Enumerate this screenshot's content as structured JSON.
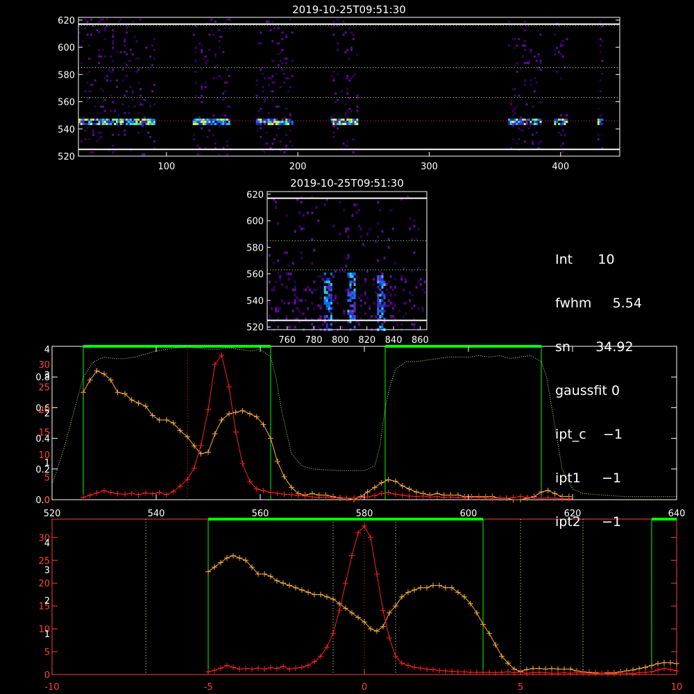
{
  "title_top": "2019-10-25T09:51:30",
  "title_mid": "2019-10-25T09:51:30",
  "info": [
    {
      "label": "Int",
      "value": "10"
    },
    {
      "label": "fwhm",
      "value": "5.54"
    },
    {
      "label": "sn",
      "value": "34.92"
    },
    {
      "label": "gaussfit",
      "value": "0"
    },
    {
      "label": "ipt_c",
      "value": "−1"
    },
    {
      "label": "ipt1",
      "value": "−1"
    },
    {
      "label": "ipt2",
      "value": "−1"
    }
  ],
  "colors": {
    "axes": "#ffffff",
    "red_curve": "#ff2020",
    "orange_curve": "#ffb040",
    "green": "#00ff00",
    "green_dotted": "#b0ff80",
    "red_axis": "#ff4040",
    "yellow_dotted": "#ffff80"
  },
  "chart_data": [
    {
      "type": "heatmap",
      "title": "2019-10-25T09:51:30",
      "xlim": [
        33,
        445
      ],
      "ylim": [
        520,
        622
      ],
      "xticks": [
        100,
        200,
        300,
        400
      ],
      "yticks": [
        520,
        540,
        560,
        580,
        600,
        620
      ],
      "hlines_solid": [
        525,
        617
      ],
      "hlines_dotted_green": [
        563,
        585,
        616
      ],
      "hline_dotted_red": 546,
      "active_columns": [
        [
          33,
          90
        ],
        [
          120,
          148
        ],
        [
          168,
          195
        ],
        [
          225,
          245
        ],
        [
          360,
          385
        ],
        [
          395,
          405
        ],
        [
          428,
          432
        ]
      ],
      "bright_band_y": 546
    },
    {
      "type": "heatmap",
      "title": "2019-10-25T09:51:30",
      "xlim": [
        745,
        865
      ],
      "ylim": [
        518,
        622
      ],
      "xticks": [
        760,
        780,
        800,
        820,
        840,
        860
      ],
      "yticks": [
        520,
        540,
        560,
        580,
        600,
        620
      ],
      "hlines_solid": [
        525,
        617
      ],
      "hlines_dotted_green": [
        563,
        585
      ],
      "bright_streaks_x": [
        790,
        808,
        830
      ]
    },
    {
      "type": "line",
      "xlim": [
        520,
        640
      ],
      "xticks": [
        520,
        540,
        560,
        580,
        600,
        620,
        640
      ],
      "ylim_left": [
        0,
        1
      ],
      "yticks_left_white": [
        "0.0",
        "0.2",
        "0.4",
        "0.6",
        "0.8"
      ],
      "yticks_left_red": [
        "0",
        "5",
        "10",
        "15",
        "20",
        "25",
        "30"
      ],
      "yticks_left_white2": [
        "1",
        "2",
        "3",
        "4"
      ],
      "green_bars": [
        [
          526,
          562
        ],
        [
          584,
          614
        ]
      ],
      "series": [
        {
          "color": "red",
          "x": [
            526,
            527.3,
            528.6,
            530,
            531.3,
            532.6,
            534,
            535.3,
            536.6,
            538,
            539.3,
            540.6,
            542,
            543.3,
            544.6,
            546,
            547.3,
            548.6,
            550,
            551.3,
            552.6,
            554,
            555.3,
            556.6,
            558,
            559.3,
            560.6,
            562,
            563.3,
            564.6,
            566,
            567.3,
            568.6,
            570,
            571.3,
            572.6,
            574,
            575.3,
            576.6,
            578,
            579.3,
            580.6,
            582,
            583.3,
            584.6,
            586,
            587.3,
            588.6,
            590,
            591.3,
            592.6,
            594,
            595.3,
            596.6,
            598,
            599.3,
            600.6,
            602,
            603.3,
            604.6,
            606,
            607.3,
            608.6,
            610,
            611.3,
            612.6,
            614,
            615.3,
            616.6,
            618,
            619.3
          ],
          "y": [
            0.5,
            1,
            1.5,
            2,
            1.6,
            1.3,
            1.2,
            1.4,
            1.1,
            1.5,
            1.3,
            1.6,
            1.1,
            1.8,
            3,
            4.5,
            7,
            12,
            20,
            30,
            32,
            25,
            15,
            8,
            4,
            2.4,
            2,
            1.6,
            1.4,
            1.2,
            1.1,
            0.9,
            0.8,
            0.6,
            0.5,
            0.6,
            0.4,
            0.5,
            0.3,
            0.4,
            0.5,
            0.6,
            0.9,
            1.4,
            1.6,
            1.2,
            1.0,
            0.8,
            0.7,
            0.8,
            0.6,
            0.7,
            0.5,
            0.6,
            0.5,
            0.4,
            0.5,
            0.5,
            0.4,
            0.3,
            0.4,
            0.3,
            0.5,
            0.7,
            0.5,
            0.4,
            0.3,
            0.4,
            0.3,
            0.2,
            0.2
          ]
        },
        {
          "color": "orange",
          "x": [
            526,
            527.3,
            528.6,
            530,
            531.3,
            532.6,
            534,
            535.3,
            536.6,
            538,
            539.3,
            540.6,
            542,
            543.3,
            544.6,
            546,
            547.3,
            548.6,
            550,
            551.3,
            552.6,
            554,
            555.3,
            556.6,
            558,
            559.3,
            560.6,
            562,
            563.3,
            564.6,
            566,
            567.3,
            568.6,
            570,
            571.3,
            572.6,
            574,
            575.3,
            576.6,
            578,
            579.3,
            580.6,
            582,
            583.3,
            584.6,
            586,
            587.3,
            588.6,
            590,
            591.3,
            592.6,
            594,
            595.3,
            596.6,
            598,
            599.3,
            600.6,
            602,
            603.3,
            604.6,
            606,
            607.3,
            608.6,
            610,
            611.3,
            612.6,
            614,
            615.3,
            616.6,
            618,
            619.3
          ],
          "y": [
            0.7,
            0.78,
            0.84,
            0.82,
            0.78,
            0.7,
            0.69,
            0.65,
            0.63,
            0.61,
            0.55,
            0.52,
            0.52,
            0.5,
            0.45,
            0.41,
            0.35,
            0.3,
            0.31,
            0.43,
            0.52,
            0.56,
            0.57,
            0.58,
            0.56,
            0.54,
            0.49,
            0.4,
            0.25,
            0.15,
            0.08,
            0.04,
            0.03,
            0.04,
            0.03,
            0.03,
            0.02,
            0.01,
            0.01,
            0.0,
            0.02,
            0.05,
            0.08,
            0.11,
            0.13,
            0.12,
            0.09,
            0.07,
            0.05,
            0.04,
            0.03,
            0.04,
            0.03,
            0.03,
            0.03,
            0.02,
            0.02,
            0.02,
            0.02,
            0.02,
            0.01,
            0.01,
            0.0,
            0.0,
            0.01,
            0.02,
            0.05,
            0.06,
            0.04,
            0.02,
            0.02
          ]
        },
        {
          "color": "green-dotted",
          "x": [
            520,
            522,
            524,
            526,
            528,
            530,
            532,
            534,
            536,
            538,
            540,
            542,
            544,
            546,
            548,
            550,
            552,
            554,
            556,
            558,
            560,
            562,
            563,
            564,
            565,
            566,
            568,
            570,
            575,
            580,
            582,
            583,
            584,
            585,
            586,
            588,
            590,
            592,
            594,
            596,
            598,
            600,
            602,
            604,
            606,
            608,
            610,
            612,
            614,
            615,
            616,
            617,
            618,
            620,
            622,
            626,
            630,
            636,
            640
          ],
          "y": [
            0.1,
            0.3,
            0.55,
            0.8,
            0.9,
            0.93,
            0.92,
            0.92,
            0.93,
            0.95,
            0.97,
            0.98,
            0.99,
            1.0,
            0.99,
            0.98,
            0.98,
            0.99,
            0.98,
            0.97,
            0.98,
            0.93,
            0.8,
            0.6,
            0.45,
            0.3,
            0.22,
            0.2,
            0.19,
            0.19,
            0.22,
            0.35,
            0.6,
            0.75,
            0.85,
            0.9,
            0.9,
            0.91,
            0.92,
            0.93,
            0.93,
            0.93,
            0.94,
            0.93,
            0.94,
            0.92,
            0.93,
            0.94,
            0.9,
            0.8,
            0.6,
            0.4,
            0.2,
            0.07,
            0.04,
            0.03,
            0.02,
            0.02,
            0.02
          ]
        }
      ]
    },
    {
      "type": "line",
      "xlim": [
        -10,
        10
      ],
      "xticks": [
        -10,
        -5,
        0,
        5,
        10
      ],
      "yticks_left_red": [
        "0",
        "5",
        "10",
        "15",
        "20",
        "25",
        "30"
      ],
      "yticks_left_white": [
        "1",
        "2",
        "3",
        "4"
      ],
      "green_bars": [
        [
          -5.0,
          3.8
        ],
        [
          9.2,
          10
        ]
      ],
      "vlines_yellow_dotted": [
        -7,
        -5,
        -1,
        0,
        1,
        5,
        7
      ],
      "series": [
        {
          "color": "red",
          "x": [
            -5.0,
            -4.8,
            -4.6,
            -4.4,
            -4.2,
            -4.0,
            -3.8,
            -3.6,
            -3.4,
            -3.2,
            -3.0,
            -2.8,
            -2.6,
            -2.4,
            -2.2,
            -2.0,
            -1.8,
            -1.6,
            -1.4,
            -1.2,
            -1.0,
            -0.8,
            -0.6,
            -0.4,
            -0.2,
            0.0,
            0.2,
            0.4,
            0.6,
            0.8,
            1.0,
            1.2,
            1.4,
            1.6,
            1.8,
            2.0,
            2.2,
            2.4,
            2.6,
            2.8,
            3.0,
            3.2,
            3.4,
            3.6,
            3.8,
            4.0,
            4.2,
            4.4,
            4.6,
            4.8,
            5.0,
            5.2,
            5.4,
            5.6,
            5.8,
            6.0,
            6.2,
            6.4,
            6.6,
            6.8,
            7.0,
            7.2,
            7.4,
            7.6,
            7.8,
            8.0,
            8.2,
            8.4,
            8.6,
            8.8,
            9.0,
            9.2,
            9.4,
            9.6,
            9.8,
            10.0
          ],
          "y": [
            0.6,
            0.9,
            1.4,
            2.0,
            1.6,
            1.2,
            1.3,
            1.2,
            1.4,
            1.2,
            1.5,
            1.3,
            1.8,
            1.2,
            1.4,
            1.6,
            2.0,
            2.8,
            4.0,
            6.0,
            9.0,
            14.0,
            20.0,
            26.0,
            31.0,
            32.5,
            30.0,
            22.0,
            14.0,
            8.0,
            4.0,
            2.5,
            2.0,
            1.6,
            1.4,
            1.2,
            1.1,
            0.9,
            0.8,
            0.7,
            0.6,
            0.6,
            0.5,
            0.5,
            0.5,
            0.5,
            0.4,
            0.5,
            0.6,
            0.4,
            0.5,
            0.3,
            0.4,
            0.5,
            0.4,
            0.3,
            0.3,
            0.4,
            0.3,
            0.4,
            0.3,
            0.3,
            0.2,
            0.3,
            0.2,
            0.2,
            0.3,
            0.3,
            0.2,
            0.4,
            0.5,
            0.6,
            1.0,
            1.3,
            1.1,
            0.8
          ]
        },
        {
          "color": "orange",
          "x": [
            -5.0,
            -4.8,
            -4.6,
            -4.4,
            -4.2,
            -4.0,
            -3.8,
            -3.6,
            -3.4,
            -3.2,
            -3.0,
            -2.8,
            -2.6,
            -2.4,
            -2.2,
            -2.0,
            -1.8,
            -1.6,
            -1.4,
            -1.2,
            -1.0,
            -0.8,
            -0.6,
            -0.4,
            -0.2,
            0.0,
            0.2,
            0.4,
            0.6,
            0.8,
            1.0,
            1.2,
            1.4,
            1.6,
            1.8,
            2.0,
            2.2,
            2.4,
            2.6,
            2.8,
            3.0,
            3.2,
            3.4,
            3.6,
            3.8,
            4.0,
            4.2,
            4.4,
            4.6,
            4.8,
            5.0,
            5.2,
            5.4,
            5.6,
            5.8,
            6.0,
            6.2,
            6.4,
            6.6,
            6.8,
            7.0,
            7.2,
            7.4,
            7.6,
            7.8,
            8.0,
            8.2,
            8.4,
            8.6,
            8.8,
            9.0,
            9.2,
            9.4,
            9.6,
            9.8,
            10.0
          ],
          "y": [
            22.5,
            23.5,
            24.5,
            25.5,
            26.0,
            25.5,
            25.0,
            23.5,
            22.0,
            22.0,
            21.5,
            20.5,
            20.0,
            19.5,
            19.0,
            18.5,
            18.0,
            17.5,
            17.5,
            17.0,
            16.5,
            15.5,
            14.5,
            13.5,
            12.5,
            11.5,
            10.0,
            9.5,
            10.5,
            13.5,
            15.0,
            17.0,
            18.0,
            18.5,
            19.0,
            19.0,
            19.5,
            19.5,
            19.0,
            19.0,
            18.0,
            17.0,
            15.5,
            13.5,
            11.0,
            9.0,
            6.5,
            4.0,
            2.5,
            1.2,
            0.7,
            1.1,
            1.3,
            1.3,
            1.2,
            1.3,
            1.2,
            1.2,
            1.2,
            0.8,
            0.6,
            0.5,
            0.4,
            0.3,
            0.4,
            0.4,
            0.6,
            0.8,
            1.0,
            1.3,
            1.6,
            2.0,
            2.4,
            2.6,
            2.6,
            2.4
          ]
        }
      ]
    }
  ]
}
